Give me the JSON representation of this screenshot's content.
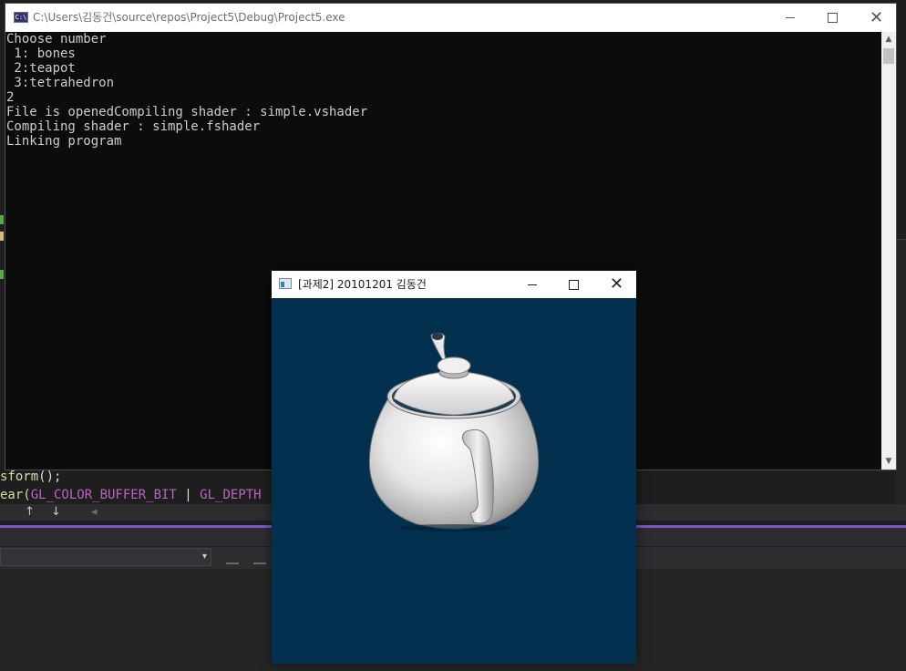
{
  "ide": {
    "code_lines": [
      {
        "before": "sform",
        "after": "();"
      },
      {
        "before": "ear(",
        "macro1": "GL_COLOR_BUFFER_BIT",
        "sep": " | ",
        "macro2": "GL_DEPTH"
      }
    ],
    "nav_up": "↑",
    "nav_down": "↓",
    "nav_left": "◂",
    "accent_color": "#7b57c7",
    "combo_arrow": "▾"
  },
  "console": {
    "title": "C:\\Users\\김동건\\source\\repos\\Project5\\Debug\\Project5.exe",
    "icon": "console-app-icon",
    "icon_text": "C:\\",
    "lines": [
      "Choose number",
      " 1: bones",
      " 2:teapot",
      " 3:tetrahedron",
      "2",
      "File is openedCompiling shader : simple.vshader",
      "Compiling shader : simple.fshader",
      "Linking program"
    ],
    "scroll_up": "▲",
    "scroll_down": "▼"
  },
  "gl_window": {
    "title": "[과제2] 20101201 김동건",
    "background_color": "#02304e",
    "scene": "teapot"
  },
  "window_buttons": {
    "close": "✕"
  }
}
